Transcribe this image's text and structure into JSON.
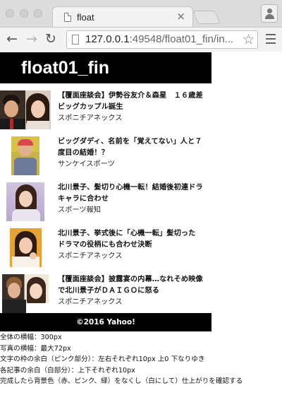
{
  "browser": {
    "tab_title": "float",
    "tab_close": "×",
    "url_host": "127.0.0.1",
    "url_rest": ":49548/float01_fin/in...",
    "icons": {
      "back": "back-arrow-icon",
      "forward": "forward-arrow-icon",
      "reload": "reload-icon",
      "bookmark": "star-icon",
      "menu": "hamburger-menu-icon",
      "profile": "person-icon"
    }
  },
  "page": {
    "title": "float01_fin",
    "articles": [
      {
        "title": "【覆面座談会】伊勢谷友介＆森星　１６歳差ビッグカップル誕生",
        "source": "スポニチアネックス"
      },
      {
        "title": "ビッグダディ、名前を「覚えてない」人と７度目の結婚！？",
        "source": "サンケイスポーツ"
      },
      {
        "title": "北川景子、髪切り心機一転！結婚後初連ドラキャラに合わせ",
        "source": "スポーツ報知"
      },
      {
        "title": "北川景子、挙式後に「心機一転」髪切った　ドラマの役柄にも合わせ決断",
        "source": "スポニチアネックス"
      },
      {
        "title": "【覆面座談会】披露宴の内幕…なれそめ映像で北川景子がＤＡＩＧＯに怒る",
        "source": "スポニチアネックス"
      }
    ],
    "footer": "©2016 Yahoo!",
    "notes": [
      "全体の横幅：300px",
      "写真の横幅：最大72px",
      "文字の枠の余白（ピンク部分）：左右それぞれ10px 上0 下なりゆき",
      "各記事の余白（白部分）：上下それぞれ10px",
      "完成したら背景色（赤、ピンク、緑）をなくし（白にして）仕上がりを確認する"
    ]
  },
  "colors": {
    "header_bg": "#000000",
    "header_text": "#ffffff",
    "page_bg": "#ffffff",
    "chrome_bg": "#ececec"
  }
}
